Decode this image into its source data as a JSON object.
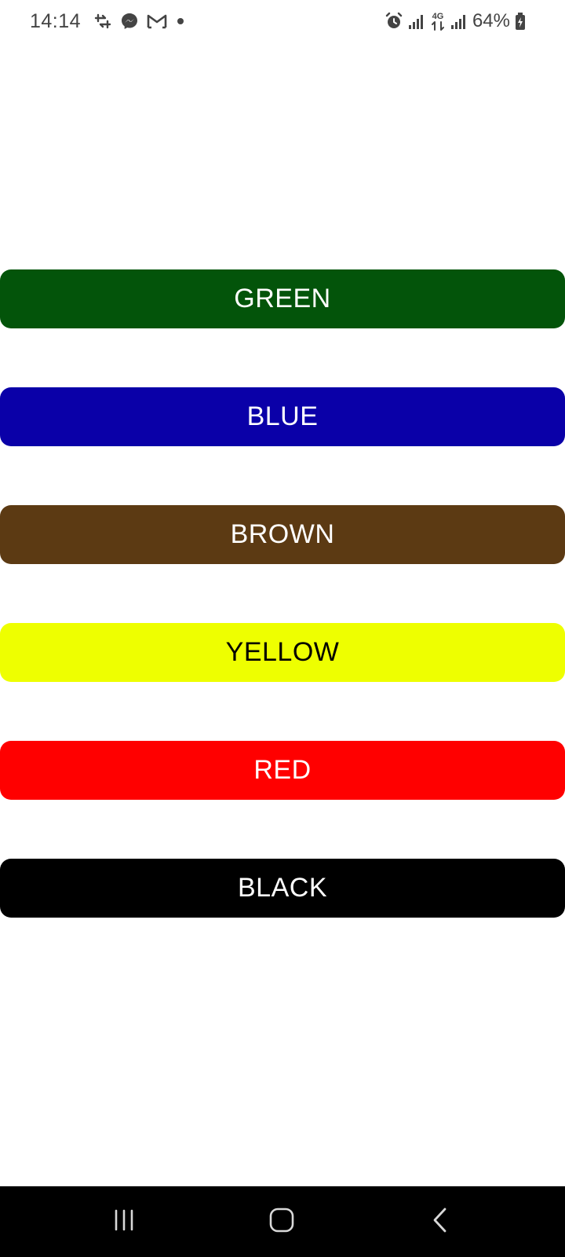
{
  "status_bar": {
    "time": "14:14",
    "battery": "64%",
    "network": "4G",
    "left_icons": [
      "transfer-icon",
      "messenger-icon",
      "gmail-icon",
      "dot-icon"
    ],
    "right_icons": [
      "alarm-icon",
      "signal-icon",
      "network-4g-icon",
      "signal-icon",
      "battery-icon"
    ]
  },
  "buttons": [
    {
      "label": "GREEN",
      "bg": "#03540A",
      "fg": "#ffffff"
    },
    {
      "label": "BLUE",
      "bg": "#0A00A8",
      "fg": "#ffffff"
    },
    {
      "label": "BROWN",
      "bg": "#5C3A13",
      "fg": "#ffffff"
    },
    {
      "label": "YELLOW",
      "bg": "#EEFF00",
      "fg": "#000000"
    },
    {
      "label": "RED",
      "bg": "#FF0000",
      "fg": "#ffffff"
    },
    {
      "label": "BLACK",
      "bg": "#000000",
      "fg": "#ffffff"
    }
  ],
  "nav_bar": {
    "items": [
      "recents-icon",
      "home-icon",
      "back-icon"
    ]
  }
}
